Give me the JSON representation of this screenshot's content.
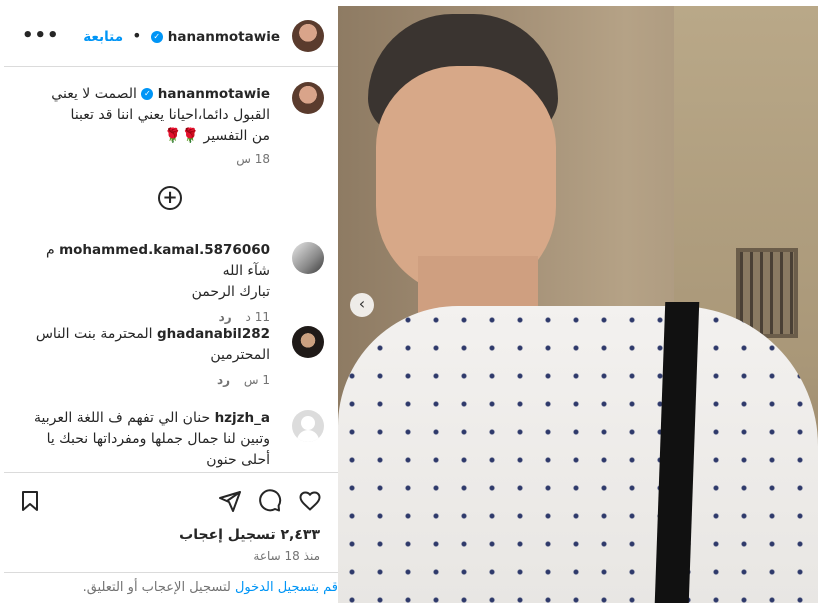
{
  "header": {
    "username": "hananmotawie",
    "separator": "•",
    "follow_label": "متابعة",
    "more_label": "•••"
  },
  "caption": {
    "username": "hananmotawie",
    "text_line1": "الصمت لا يعني",
    "text_line2": "القبول دائما،احيانا يعني اننا قد تعبنا",
    "text_line3": "من التفسير",
    "emoji": "🌹🌹",
    "time": "18 س"
  },
  "load_more_icon": "plus-circle-icon",
  "comments": [
    {
      "username": "mohammed.kamal.5876060",
      "text1": "م شآء الله",
      "text2": "تبارك الرحمن",
      "time": "11 د",
      "reply": "رد"
    },
    {
      "username": "ghadanabil282",
      "text1": "المحترمة بنت الناس",
      "text2": "المحترمين",
      "time": "1 س",
      "reply": "رد"
    },
    {
      "username": "hzjzh_a",
      "text1": "حنان الي تفهم ف اللغة العربية",
      "text2": "وتبين لنا جمال جملها ومفرداتها نحبك يا",
      "text3": "أحلى حنون"
    }
  ],
  "actions": {
    "likes": "٢,٤٣٣ تسجيل إعجاب",
    "post_time": "منذ 18 ساعة",
    "login_link": "قم بتسجيل الدخول",
    "login_rest": " لتسجيل الإعجاب أو التعليق."
  },
  "colors": {
    "accent": "#0095f6",
    "text": "#262626",
    "muted": "#737373",
    "border": "#dbdbdb"
  }
}
